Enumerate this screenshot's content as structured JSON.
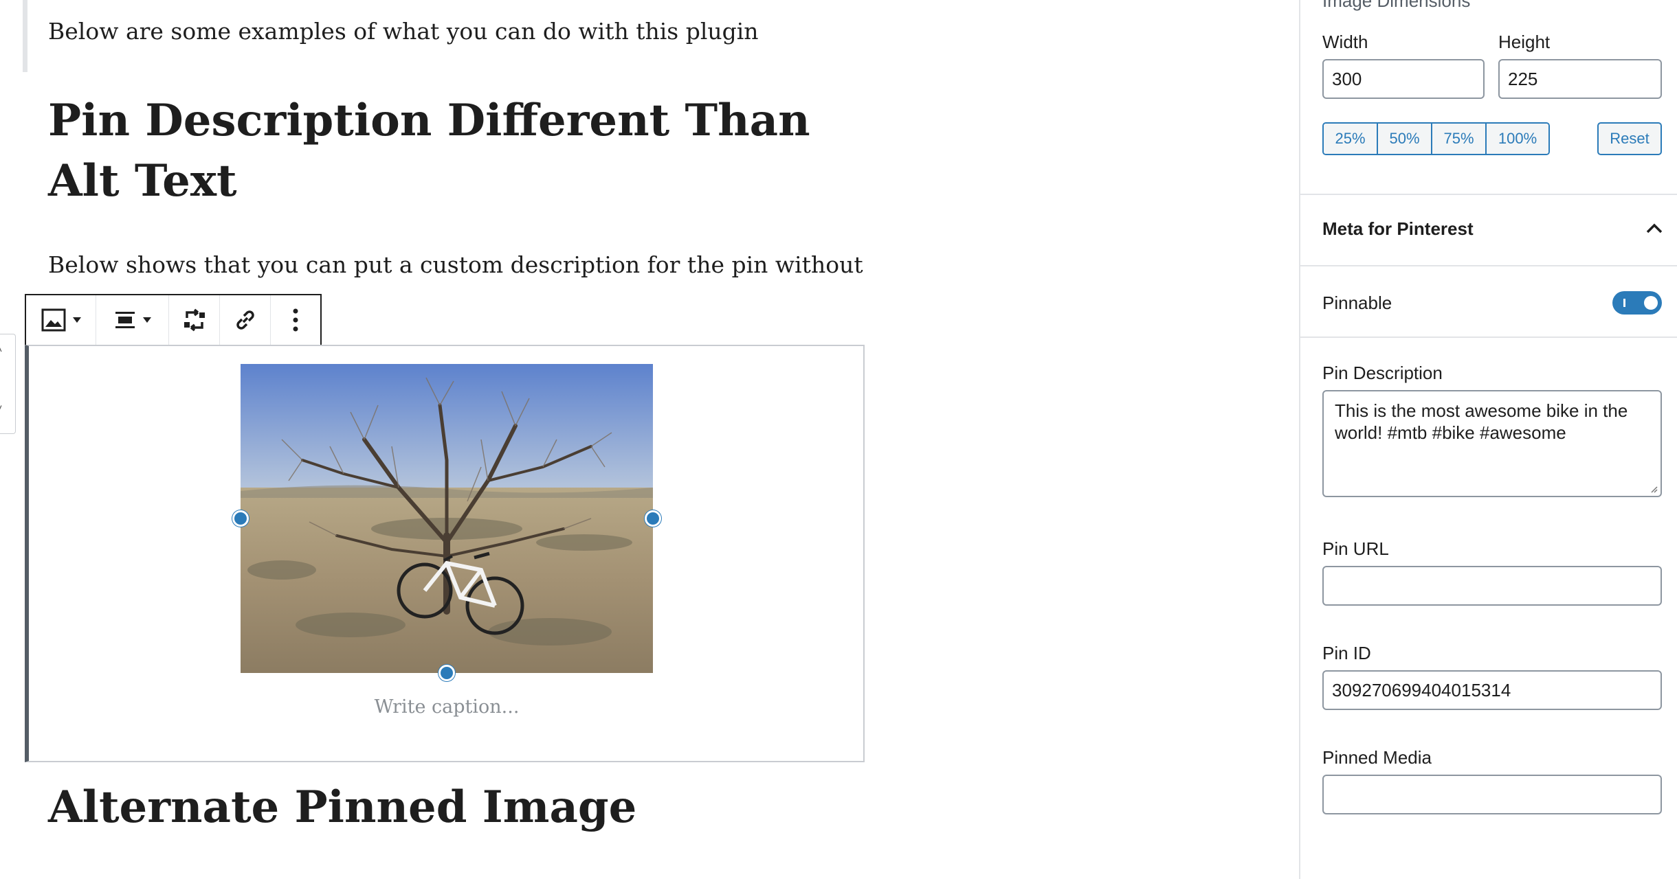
{
  "editor": {
    "intro_text": "Below are some examples of what you can do with this plugin",
    "heading1": "Pin Description Different Than Alt Text",
    "paragraph2": "Below shows that you can put a custom description for the pin without",
    "caption_placeholder": "Write caption...",
    "heading2": "Alternate Pinned Image"
  },
  "toolbar": {
    "icons": [
      "image-icon",
      "align-center-icon",
      "replace-icon",
      "link-icon",
      "more-options-icon"
    ]
  },
  "sidebar": {
    "dimensions_label": "Image Dimensions",
    "width_label": "Width",
    "width_value": "300",
    "height_label": "Height",
    "height_value": "225",
    "scale_buttons": [
      "25%",
      "50%",
      "75%",
      "100%"
    ],
    "reset_label": "Reset",
    "panel_title": "Meta for Pinterest",
    "pinnable_label": "Pinnable",
    "pinnable_on": true,
    "pin_description_label": "Pin Description",
    "pin_description_value": "This is the most awesome bike in the world! #mtb #bike #awesome",
    "pin_url_label": "Pin URL",
    "pin_url_value": "",
    "pin_id_label": "Pin ID",
    "pin_id_value": "309270699404015314",
    "pinned_media_label": "Pinned Media",
    "pinned_media_value": ""
  },
  "colors": {
    "accent": "#2b7bb9",
    "text": "#1e1e1e",
    "border": "#8d96a0"
  }
}
